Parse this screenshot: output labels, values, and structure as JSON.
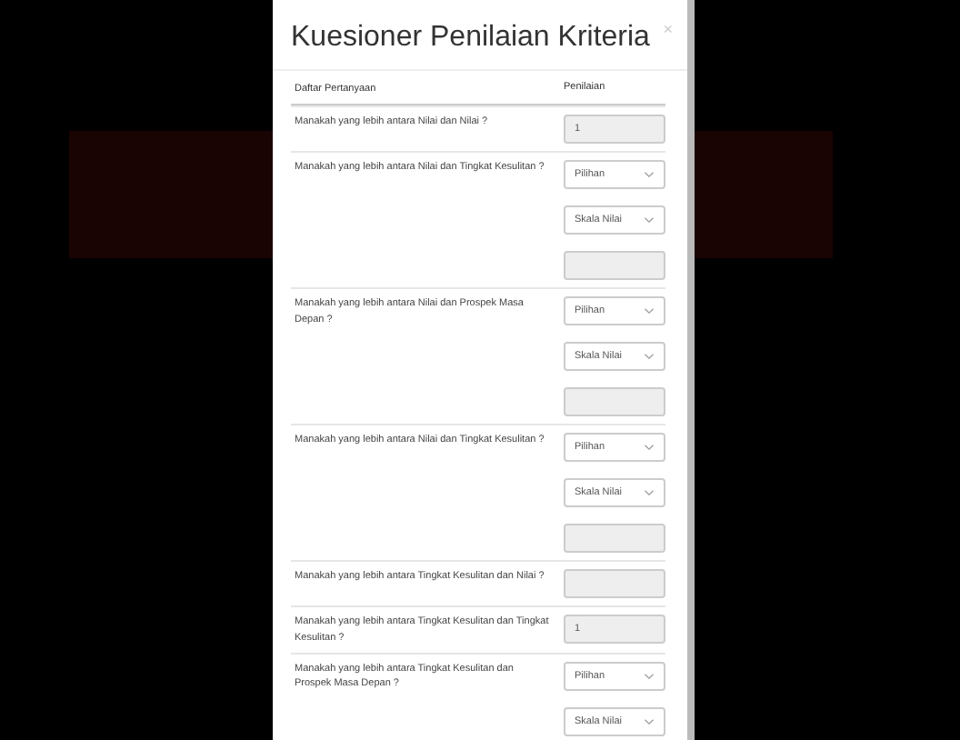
{
  "modal": {
    "title": "Kuesioner Penilaian Kriteria",
    "close": "×"
  },
  "table": {
    "columns": [
      "Daftar Pertanyaan",
      "Penilaian"
    ],
    "rows": [
      {
        "question": "Manakah yang lebih antara Nilai dan Nilai ?",
        "fields": [
          {
            "kind": "input",
            "value": "1",
            "disabled": true
          }
        ]
      },
      {
        "question": "Manakah yang lebih antara Nilai dan Tingkat Kesulitan ?",
        "fields": [
          {
            "kind": "select",
            "value": "Pilihan"
          },
          {
            "kind": "select",
            "value": "Skala Nilai"
          },
          {
            "kind": "input",
            "disabled": true
          }
        ]
      },
      {
        "question": "Manakah yang lebih antara Nilai dan Prospek Masa Depan ?",
        "fields": [
          {
            "kind": "select",
            "value": "Pilihan"
          },
          {
            "kind": "select",
            "value": "Skala Nilai"
          },
          {
            "kind": "input",
            "disabled": true
          }
        ]
      },
      {
        "question": "Manakah yang lebih antara Nilai dan Tingkat Kesulitan ?",
        "fields": [
          {
            "kind": "select",
            "value": "Pilihan"
          },
          {
            "kind": "select",
            "value": "Skala Nilai"
          },
          {
            "kind": "input",
            "disabled": true
          }
        ]
      },
      {
        "question": "Manakah yang lebih antara Tingkat Kesulitan dan Nilai ?",
        "fields": [
          {
            "kind": "input",
            "disabled": true
          }
        ]
      },
      {
        "question": "Manakah yang lebih antara Tingkat Kesulitan dan Tingkat Kesulitan ?",
        "fields": [
          {
            "kind": "input",
            "value": "1",
            "disabled": true
          }
        ]
      },
      {
        "question": "Manakah yang lebih antara Tingkat Kesulitan dan Prospek Masa Depan ?",
        "fields": [
          {
            "kind": "select",
            "value": "Pilihan"
          },
          {
            "kind": "select",
            "value": "Skala Nilai"
          }
        ]
      }
    ]
  }
}
